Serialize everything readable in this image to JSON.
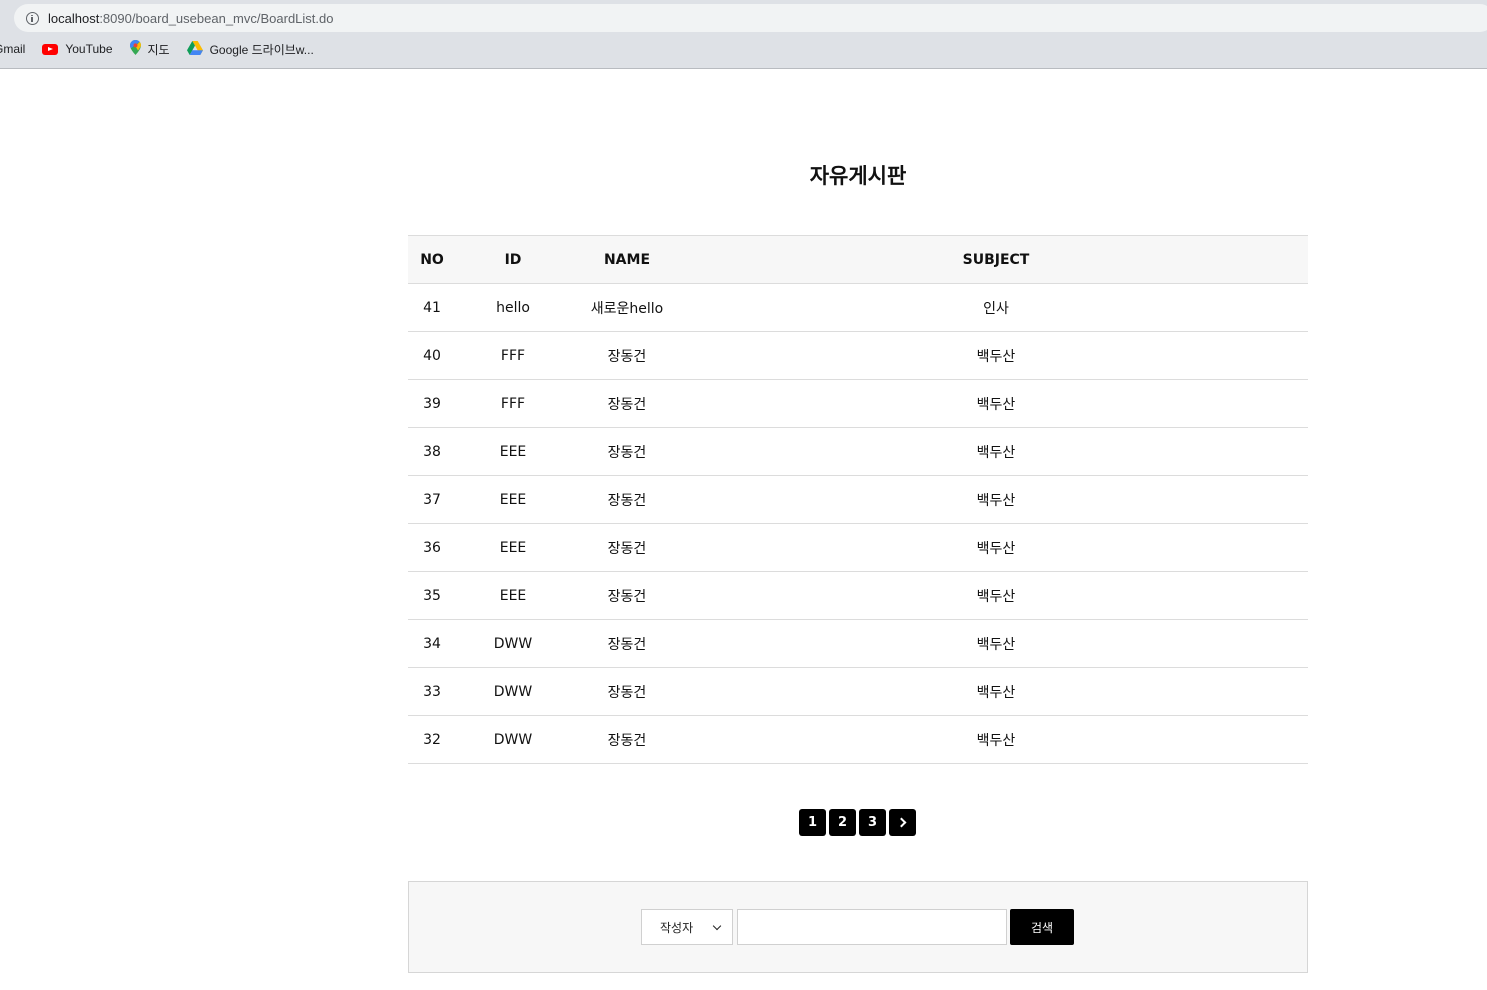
{
  "browser": {
    "url_host": "localhost",
    "url_path": ":8090/board_usebean_mvc/BoardList.do",
    "bookmarks": [
      {
        "label": "Gmail",
        "icon": "gmail-icon"
      },
      {
        "label": "YouTube",
        "icon": "youtube-icon"
      },
      {
        "label": "지도",
        "icon": "maps-icon"
      },
      {
        "label": "Google 드라이브w...",
        "icon": "drive-icon"
      }
    ]
  },
  "page": {
    "title": "자유게시판"
  },
  "table": {
    "headers": [
      "NO",
      "ID",
      "NAME",
      "SUBJECT"
    ],
    "rows": [
      [
        "41",
        "hello",
        "새로운hello",
        "인사"
      ],
      [
        "40",
        "FFF",
        "장동건",
        "백두산"
      ],
      [
        "39",
        "FFF",
        "장동건",
        "백두산"
      ],
      [
        "38",
        "EEE",
        "장동건",
        "백두산"
      ],
      [
        "37",
        "EEE",
        "장동건",
        "백두산"
      ],
      [
        "36",
        "EEE",
        "장동건",
        "백두산"
      ],
      [
        "35",
        "EEE",
        "장동건",
        "백두산"
      ],
      [
        "34",
        "DWW",
        "장동건",
        "백두산"
      ],
      [
        "33",
        "DWW",
        "장동건",
        "백두산"
      ],
      [
        "32",
        "DWW",
        "장동건",
        "백두산"
      ]
    ]
  },
  "pagination": {
    "pages": [
      "1",
      "2",
      "3"
    ],
    "next_icon": "chevron-right-icon"
  },
  "search": {
    "selected_option": "작성자",
    "input_value": "",
    "button_label": "검색"
  },
  "colors": {
    "button_bg": "#000000",
    "header_bg": "#f7f7f7",
    "border": "#dcdcdc"
  }
}
